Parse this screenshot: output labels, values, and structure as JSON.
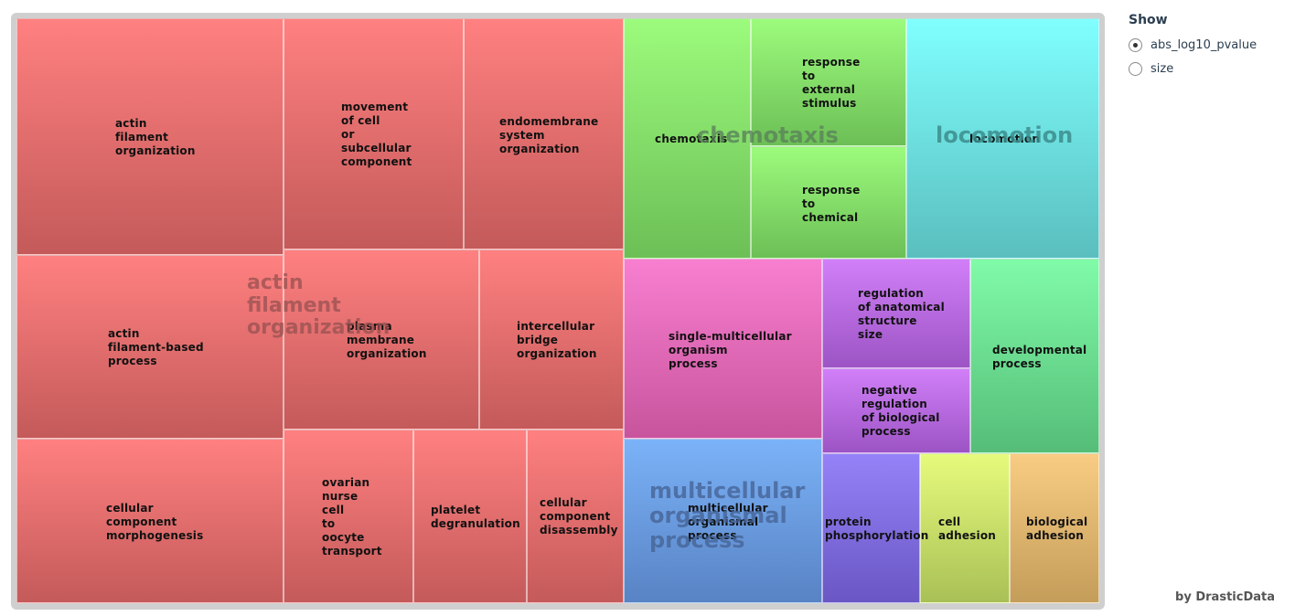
{
  "legend": {
    "title": "Show",
    "options": [
      "abs_log10_pvalue",
      "size"
    ],
    "selected": "abs_log10_pvalue"
  },
  "credit": "by DrasticData",
  "colors": {
    "red": [
      "#ff8080",
      "#c45a5a"
    ],
    "green": [
      "#9cfb7c",
      "#6cbf56"
    ],
    "cyan": [
      "#80ffff",
      "#5abebe"
    ],
    "pink": [
      "#f87fd0",
      "#c8549d"
    ],
    "violet": [
      "#d17ff8",
      "#9c54c4"
    ],
    "mint": [
      "#80fba8",
      "#55bd78"
    ],
    "blue": [
      "#7bb2f8",
      "#5883c4"
    ],
    "purple": [
      "#9582f8",
      "#6a57c4"
    ],
    "lime": [
      "#e6fb7c",
      "#a9c056"
    ],
    "orange": [
      "#f8cc82",
      "#c49d5a"
    ]
  },
  "chart_data": {
    "type": "treemap",
    "groups": [
      {
        "name": "actin filament organization",
        "color": "red",
        "label": {
          "fontSize": 22,
          "color": "rgba(150,80,80,0.75)"
        },
        "items": [
          {
            "name": "actin filament organization"
          },
          {
            "name": "movement of cell or subcellular component"
          },
          {
            "name": "endomembrane system organization"
          },
          {
            "name": "actin filament-based process"
          },
          {
            "name": "plasma membrane organization"
          },
          {
            "name": "intercellular bridge organization"
          },
          {
            "name": "cellular component morphogenesis"
          },
          {
            "name": "ovarian nurse cell to oocyte transport"
          },
          {
            "name": "platelet degranulation"
          },
          {
            "name": "cellular component disassembly"
          }
        ]
      },
      {
        "name": "chemotaxis",
        "color": "green",
        "label": {
          "fontSize": 24,
          "color": "rgba(90,130,90,0.8)"
        },
        "items": [
          {
            "name": "chemotaxis"
          },
          {
            "name": "response to external stimulus"
          },
          {
            "name": "response to chemical"
          }
        ]
      },
      {
        "name": "locomotion",
        "color": "cyan",
        "label": {
          "fontSize": 24,
          "color": "rgba(60,140,140,0.85)"
        },
        "items": [
          {
            "name": "locomotion"
          }
        ]
      },
      {
        "name": "multicellular organismal process",
        "color": "pink",
        "items": [
          {
            "name": "single-multicellular organism process"
          }
        ]
      },
      {
        "name": "regulation of anatomical structure size",
        "color": "violet",
        "items": [
          {
            "name": "regulation of anatomical structure size"
          },
          {
            "name": "negative regulation of biological process"
          }
        ]
      },
      {
        "name": "developmental process",
        "color": "mint",
        "items": [
          {
            "name": "developmental process"
          }
        ]
      },
      {
        "name": "multicellular organismal process",
        "color": "blue",
        "label": {
          "fontSize": 24,
          "color": "rgba(70,100,150,0.8)"
        },
        "items": [
          {
            "name": "multicellular organismal process"
          }
        ]
      },
      {
        "name": "protein phosphorylation",
        "color": "purple",
        "items": [
          {
            "name": "protein phosphorylation"
          }
        ]
      },
      {
        "name": "cell adhesion",
        "color": "lime",
        "items": [
          {
            "name": "cell adhesion"
          }
        ]
      },
      {
        "name": "biological adhesion",
        "color": "orange",
        "items": [
          {
            "name": "biological adhesion"
          }
        ]
      }
    ]
  }
}
